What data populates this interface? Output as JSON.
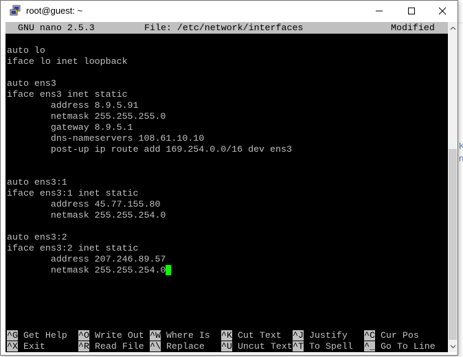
{
  "window": {
    "title": "root@guest: ~",
    "controls": {
      "minimize": "—",
      "maximize": "□",
      "close": "✕"
    }
  },
  "nano": {
    "header": {
      "version": "GNU nano 2.5.3",
      "file": "File: /etc/network/interfaces",
      "status": "Modified"
    },
    "lines": [
      "auto lo",
      "iface lo inet loopback",
      "",
      "auto ens3",
      "iface ens3 inet static",
      "        address 8.9.5.91",
      "        netmask 255.255.255.0",
      "        gateway 8.9.5.1",
      "        dns-nameservers 108.61.10.10",
      "        post-up ip route add 169.254.0.0/16 dev ens3",
      "",
      "",
      "auto ens3:1",
      "iface ens3:1 inet static",
      "        address 45.77.155.80",
      "        netmask 255.255.254.0",
      "",
      "auto ens3:2",
      "iface ens3:2 inet static",
      "        address 207.246.89.57",
      "        netmask 255.255.254.0"
    ],
    "cursor_color": "#00ff00",
    "shortcuts": [
      [
        {
          "key": "^G",
          "label": "Get Help"
        },
        {
          "key": "^O",
          "label": "Write Out"
        },
        {
          "key": "^W",
          "label": "Where Is"
        },
        {
          "key": "^K",
          "label": "Cut Text"
        },
        {
          "key": "^J",
          "label": "Justify"
        },
        {
          "key": "^C",
          "label": "Cur Pos"
        }
      ],
      [
        {
          "key": "^X",
          "label": "Exit"
        },
        {
          "key": "^R",
          "label": "Read File"
        },
        {
          "key": "^\\",
          "label": "Replace"
        },
        {
          "key": "^U",
          "label": "Uncut Text"
        },
        {
          "key": "^T",
          "label": "To Spell"
        },
        {
          "key": "^_",
          "label": "Go To Line"
        }
      ]
    ]
  },
  "scrollbar": {
    "up_arrow": "^",
    "down_arrow": "v"
  },
  "background": {
    "mark1": "K",
    "mark2": "n"
  }
}
